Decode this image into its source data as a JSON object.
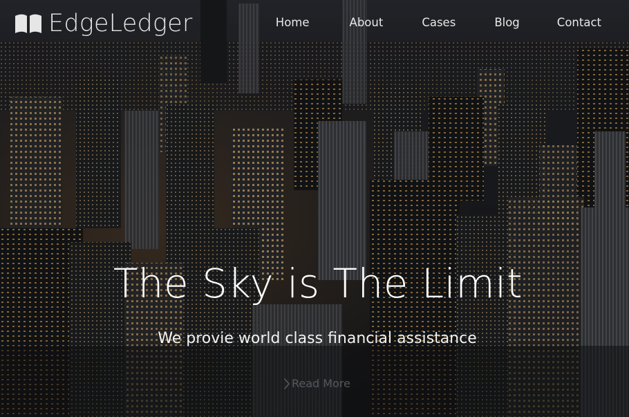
{
  "brand": {
    "name": "EdgeLedger",
    "icon": "open-book-icon"
  },
  "nav": {
    "items": [
      "Home",
      "About",
      "Cases",
      "Blog",
      "Contact"
    ]
  },
  "hero": {
    "title": "The Sky is The Limit",
    "subtitle": "We provie world class financial assistance",
    "cta_label": "Read More",
    "cta_icon": "chevron-right-icon",
    "background": "city-skyline-night-photo"
  },
  "colors": {
    "nav_text": "#e8e8e8",
    "title": "#ffffff",
    "cta_text": "#55585f"
  }
}
